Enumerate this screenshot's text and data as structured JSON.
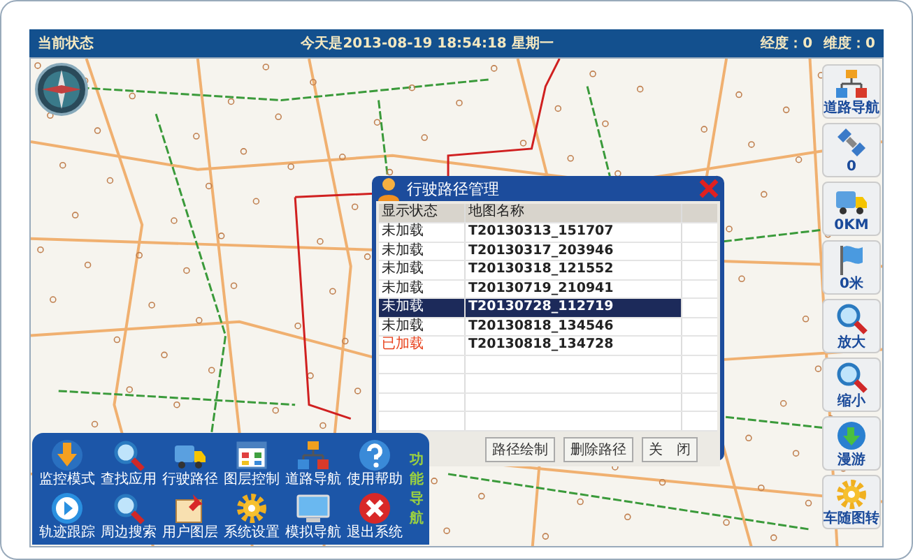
{
  "header": {
    "title": "当前状态",
    "datetime": "今天是2013-08-19 18:54:18 星期一",
    "coords": [
      "经度：0",
      "维度：0"
    ]
  },
  "right_tools": [
    {
      "kind": "road",
      "label": "道路导航"
    },
    {
      "kind": "satellite",
      "label": "0"
    },
    {
      "kind": "truck",
      "label": "0KM"
    },
    {
      "kind": "flag",
      "label": "0米"
    },
    {
      "kind": "zoom-in",
      "label": "放大"
    },
    {
      "kind": "zoom-out",
      "label": "缩小"
    },
    {
      "kind": "globe",
      "label": "漫游"
    },
    {
      "kind": "gear",
      "label": "车随图转"
    }
  ],
  "dialog": {
    "title": "行驶路径管理",
    "columns": [
      "显示状态",
      "地图名称"
    ],
    "rows": [
      {
        "status": "未加载",
        "name": "T20130313_151707",
        "loaded": false,
        "selected": false
      },
      {
        "status": "未加载",
        "name": "T20130317_203946",
        "loaded": false,
        "selected": false
      },
      {
        "status": "未加载",
        "name": "T20130318_121552",
        "loaded": false,
        "selected": false
      },
      {
        "status": "未加载",
        "name": "T20130719_210941",
        "loaded": false,
        "selected": false
      },
      {
        "status": "未加载",
        "name": "T20130728_112719",
        "loaded": false,
        "selected": true
      },
      {
        "status": "未加载",
        "name": "T20130818_134546",
        "loaded": false,
        "selected": false
      },
      {
        "status": "已加载",
        "name": "T20130818_134728",
        "loaded": true,
        "selected": false
      }
    ],
    "buttons": [
      "路径绘制",
      "删除路径",
      "关　闭"
    ]
  },
  "function_panel": {
    "side_label": "功能导航",
    "items": [
      {
        "kind": "monitor",
        "label": "监控模式"
      },
      {
        "kind": "search",
        "label": "查找应用"
      },
      {
        "kind": "truck",
        "label": "行驶路径"
      },
      {
        "kind": "layers",
        "label": "图层控制"
      },
      {
        "kind": "road",
        "label": "道路导航"
      },
      {
        "kind": "help",
        "label": "使用帮助"
      },
      {
        "kind": "play",
        "label": "轨迹跟踪"
      },
      {
        "kind": "search",
        "label": "周边搜索"
      },
      {
        "kind": "pin",
        "label": "用户图层"
      },
      {
        "kind": "gear",
        "label": "系统设置"
      },
      {
        "kind": "screen",
        "label": "模拟导航"
      },
      {
        "kind": "exit",
        "label": "退出系统"
      }
    ]
  }
}
